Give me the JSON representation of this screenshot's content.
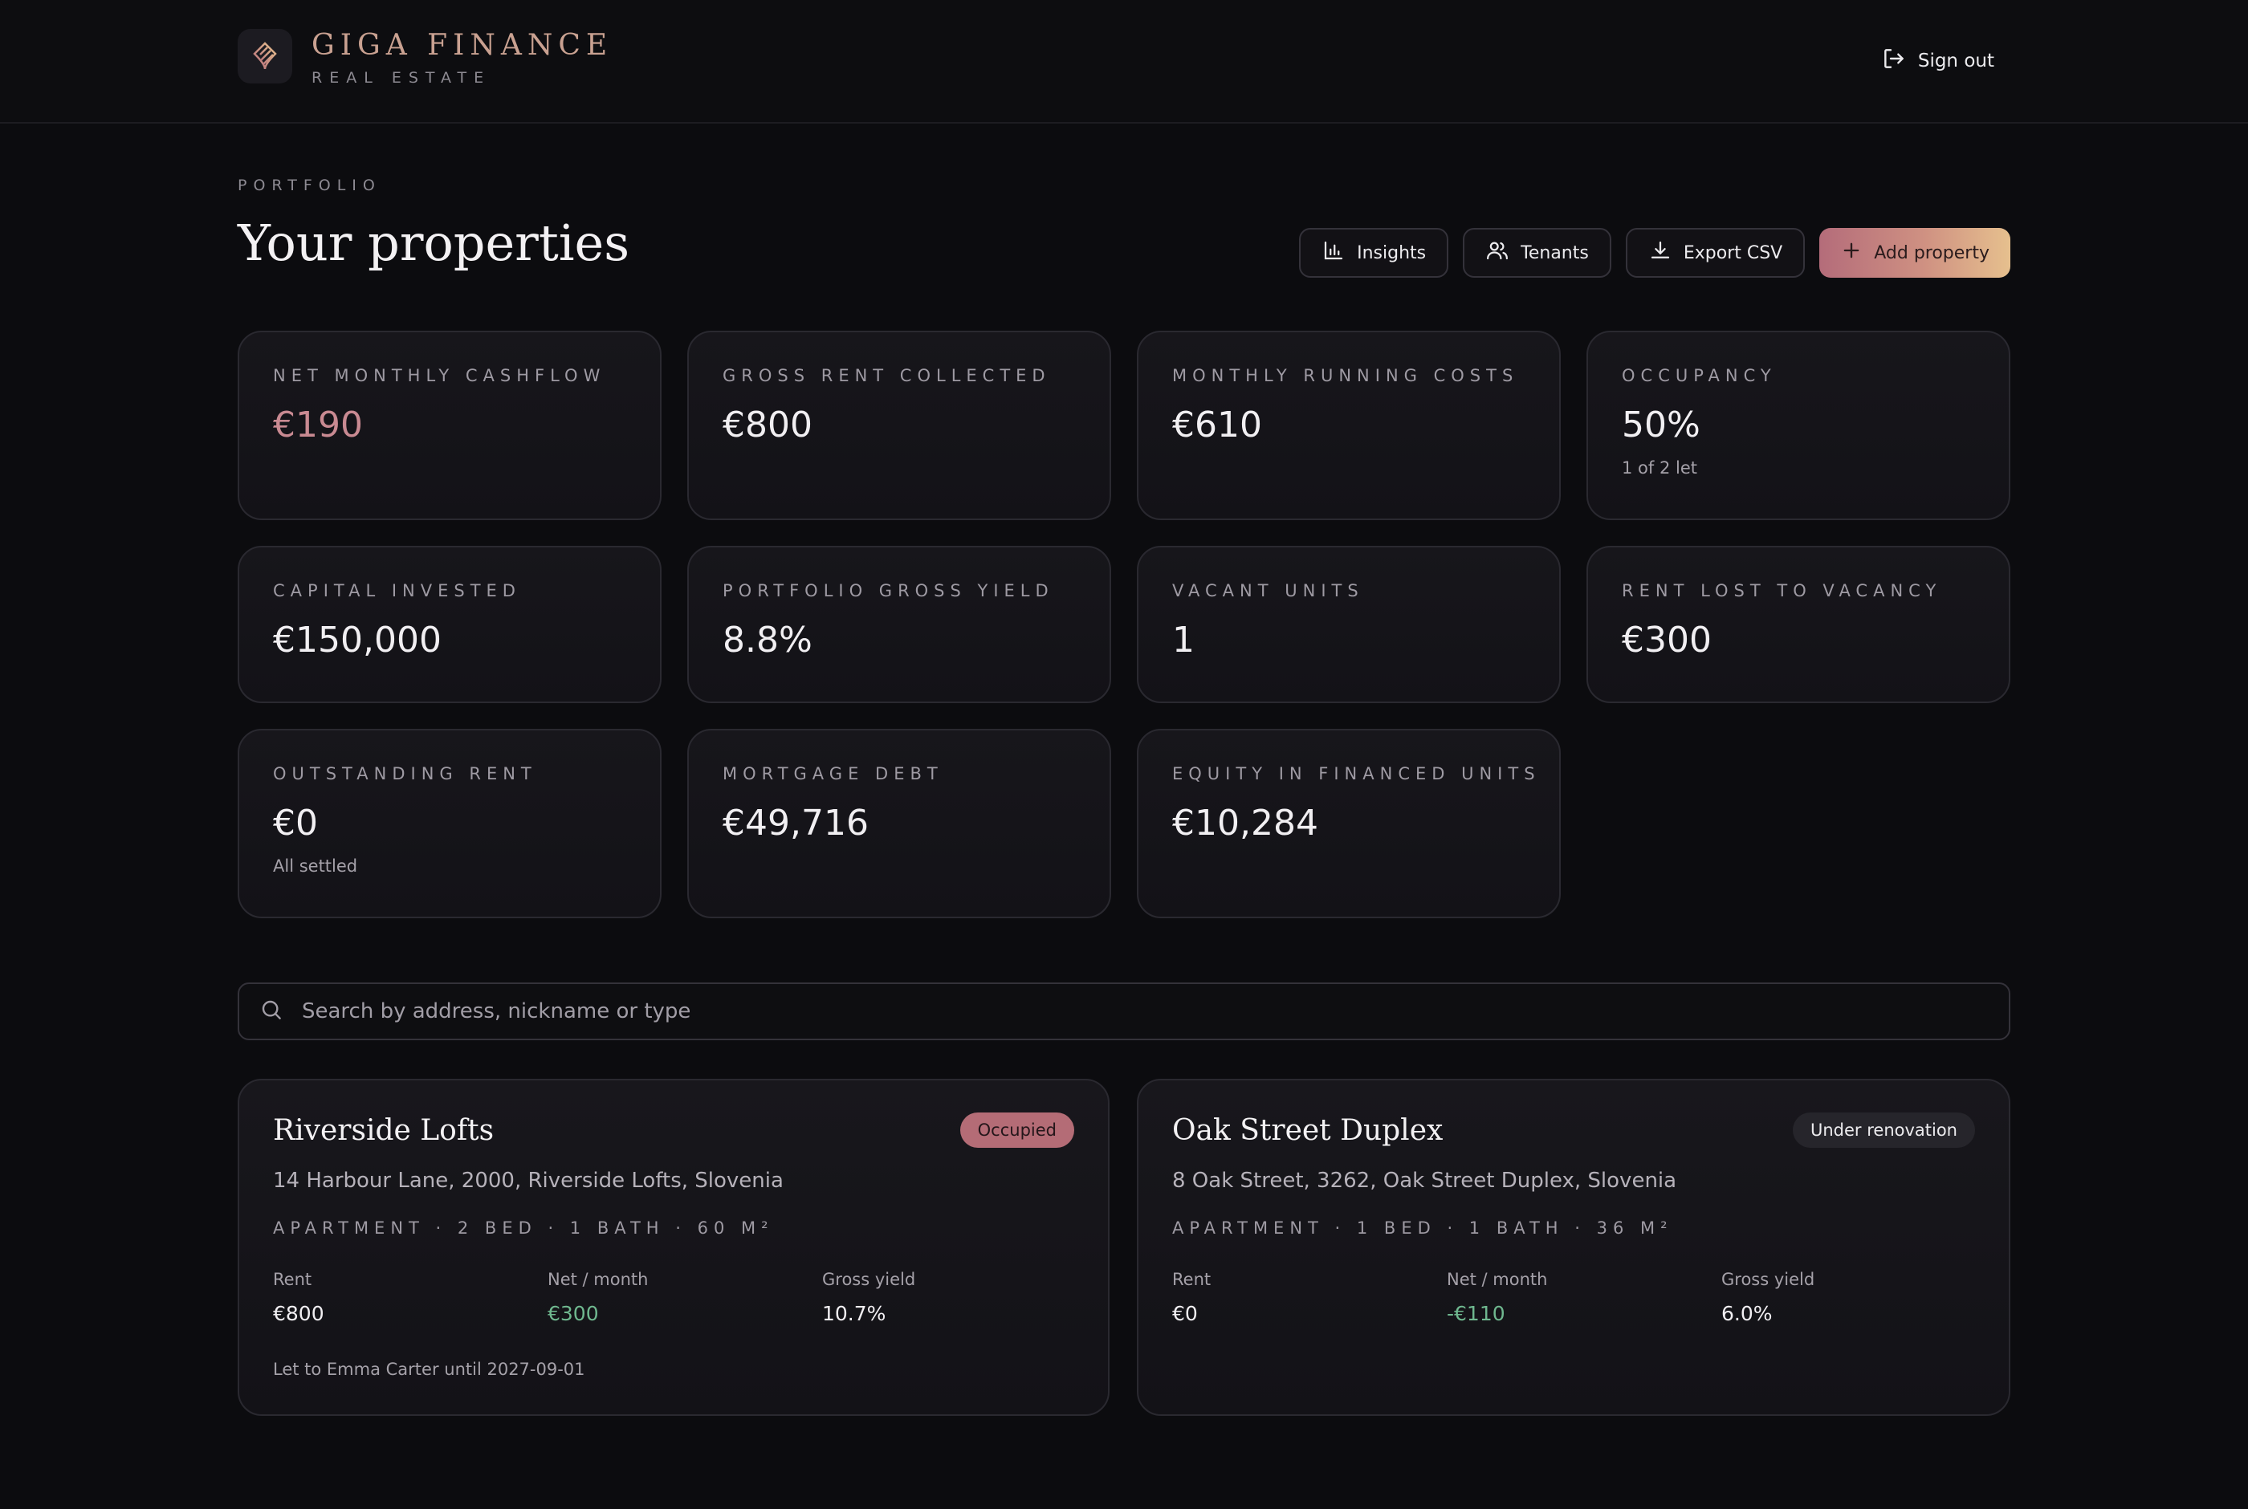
{
  "brand": {
    "name": "GIGA FINANCE",
    "tagline": "REAL ESTATE",
    "colors": {
      "accent": "#c98a92",
      "gold": "#e6c08e",
      "positive": "#6fb88f",
      "background": "#0c0c0f"
    }
  },
  "header": {
    "sign_out_label": "Sign out",
    "sign_out_icon": "sign-out-icon"
  },
  "page": {
    "eyebrow": "PORTFOLIO",
    "title": "Your properties"
  },
  "actions": {
    "insights": {
      "label": "Insights",
      "icon": "bar-chart-icon"
    },
    "tenants": {
      "label": "Tenants",
      "icon": "users-icon"
    },
    "export": {
      "label": "Export CSV",
      "icon": "download-icon"
    },
    "add": {
      "label": "Add property",
      "icon": "plus-icon"
    }
  },
  "stats": [
    {
      "label": "NET MONTHLY CASHFLOW",
      "value": "€190",
      "sub": ""
    },
    {
      "label": "GROSS RENT COLLECTED",
      "value": "€800",
      "sub": ""
    },
    {
      "label": "MONTHLY RUNNING COSTS",
      "value": "€610",
      "sub": ""
    },
    {
      "label": "OCCUPANCY",
      "value": "50%",
      "sub": "1 of 2 let"
    },
    {
      "label": "CAPITAL INVESTED",
      "value": "€150,000",
      "sub": ""
    },
    {
      "label": "PORTFOLIO GROSS YIELD",
      "value": "8.8%",
      "sub": ""
    },
    {
      "label": "VACANT UNITS",
      "value": "1",
      "sub": ""
    },
    {
      "label": "RENT LOST TO VACANCY",
      "value": "€300",
      "sub": ""
    },
    {
      "label": "OUTSTANDING RENT",
      "value": "€0",
      "sub": "All settled"
    },
    {
      "label": "MORTGAGE DEBT",
      "value": "€49,716",
      "sub": ""
    },
    {
      "label": "EQUITY IN FINANCED UNITS",
      "value": "€10,284",
      "sub": ""
    }
  ],
  "search": {
    "placeholder": "Search by address, nickname or type",
    "value": ""
  },
  "properties": [
    {
      "name": "Riverside Lofts",
      "status": "Occupied",
      "address": "14 Harbour Lane, 2000, Riverside Lofts, Slovenia",
      "spec": "APARTMENT · 2 BED · 1 BATH · 60 M²",
      "rent_label": "Rent",
      "rent": "€800",
      "net_label": "Net / month",
      "net": "€300",
      "yield_label": "Gross yield",
      "yield": "10.7%",
      "note": "Let to Emma Carter until 2027-09-01"
    },
    {
      "name": "Oak Street Duplex",
      "status": "Under renovation",
      "address": "8 Oak Street, 3262, Oak Street Duplex, Slovenia",
      "spec": "APARTMENT · 1 BED · 1 BATH · 36 M²",
      "rent_label": "Rent",
      "rent": "€0",
      "net_label": "Net / month",
      "net": "-€110",
      "yield_label": "Gross yield",
      "yield": "6.0%",
      "note": ""
    }
  ]
}
